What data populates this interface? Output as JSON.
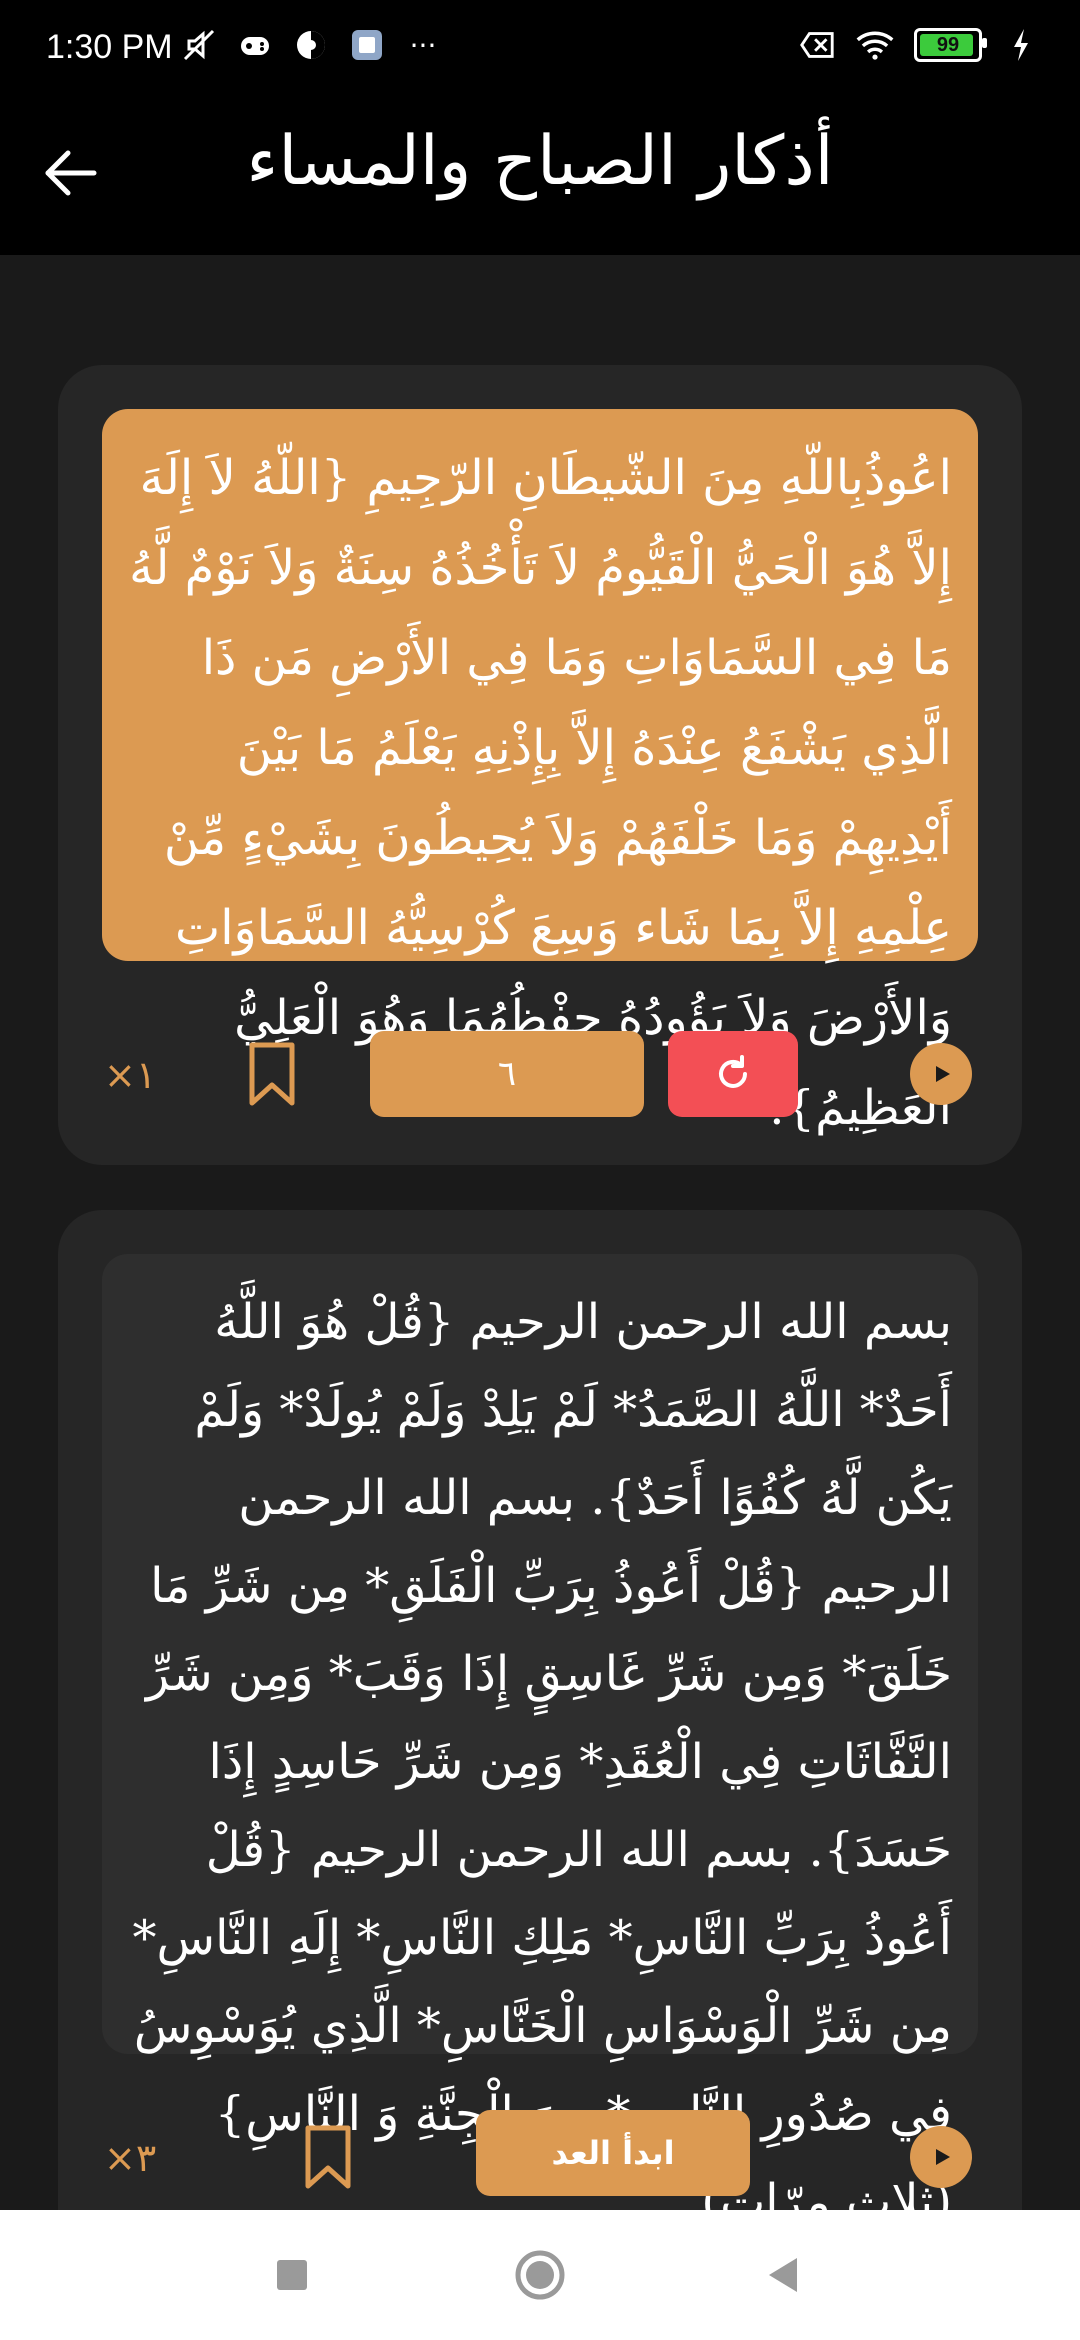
{
  "status_bar": {
    "time": "1:30 PM",
    "left_icons": [
      "mute-icon",
      "game-icon",
      "vpn-icon",
      "app-icon",
      "more-icon"
    ],
    "more": "···",
    "battery_level": "99",
    "right_icons": [
      "no-sim-icon",
      "wifi-icon",
      "battery-icon",
      "charging-icon"
    ]
  },
  "app_bar": {
    "title": "أذكار الصباح والمساء",
    "back_icon": "arrow-left-icon"
  },
  "colors": {
    "accent": "#dc9a52",
    "reset": "#f34f55",
    "card_bg": "#262626",
    "page_bg": "#1a1a1a"
  },
  "cards": [
    {
      "text": "اعُوذُبِاللّهِ مِنَ الشّيطَانِ الرّجِيمِ {اللّهُ لاَ إِلَهَ إِلاَّ هُوَ الْحَيُّ الْقَيُّومُ لاَ تَأْخُذُهُ سِنَةٌ وَلاَ نَوْمٌ لَّهُ مَا فِي السَّمَاوَاتِ وَمَا فِي الأَرْضِ مَن ذَا الَّذِي يَشْفَعُ عِنْدَهُ إِلاَّ بِإِذْنِهِ يَعْلَمُ مَا بَيْنَ أَيْدِيهِمْ وَمَا خَلْفَهُمْ وَلاَ يُحِيطُونَ بِشَيْءٍ مِّنْ عِلْمِهِ إِلاَّ بِمَا شَاء وَسِعَ كُرْسِيُّهُ السَّمَاوَاتِ وَالأَرْضَ وَلاَ يَؤُودُهُ حِفْظُهُمَا وَهُوَ الْعَلِيُّ الْعَظِيمُ}.",
      "repeat_label": "×١",
      "counter_value": "٦"
    },
    {
      "text": "بسم الله الرحمن الرحيم {قُلْ هُوَ اللَّهُ أَحَدٌ* اللَّهُ الصَّمَدُ* لَمْ يَلِدْ وَلَمْ يُولَدْ* وَلَمْ يَكُن لَّهُ كُفُوًا أَحَدٌ}. بسم الله الرحمن الرحيم {قُلْ أَعُوذُ بِرَبِّ الْفَلَقِ* مِن شَرِّ مَا خَلَقَ* وَمِن شَرِّ غَاسِقٍ إِذَا وَقَبَ* وَمِن شَرِّ النَّفَّاثَاتِ فِي الْعُقَدِ* وَمِن شَرِّ حَاسِدٍ إِذَا حَسَدَ}. بسم الله الرحمن الرحيم {قُلْ أَعُوذُ بِرَبِّ النَّاسِ* مَلِكِ النَّاسِ* إِلَهِ النَّاسِ* مِن شَرِّ الْوَسْوَاسِ الْخَنَّاسِ* الَّذِي يُوَسْوِسُ فِي صُدُورِ النَّاسِ* مِنَ الْجِنَّةِ وَ النَّاسِ} (ثلاث مرّاتٍ).",
      "repeat_label": "×٣",
      "start_label": "ابدأ العد"
    }
  ],
  "nav_bar": {
    "icons": [
      "recents-square-icon",
      "home-circle-icon",
      "back-triangle-icon"
    ]
  }
}
